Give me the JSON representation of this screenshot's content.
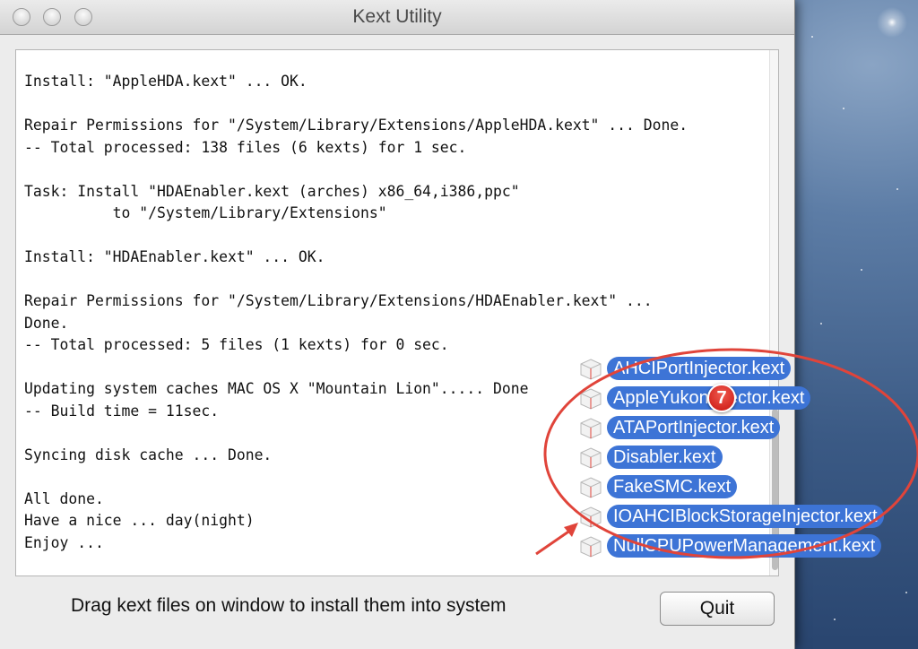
{
  "window": {
    "title": "Kext Utility"
  },
  "log": {
    "lines": [
      "Install: \"AppleHDA.kext\" ... OK.",
      "",
      "Repair Permissions for \"/System/Library/Extensions/AppleHDA.kext\" ... Done.",
      "-- Total processed: 138 files (6 kexts) for 1 sec.",
      "",
      "Task: Install \"HDAEnabler.kext (arches) x86_64,i386,ppc\"",
      "          to \"/System/Library/Extensions\"",
      "",
      "Install: \"HDAEnabler.kext\" ... OK.",
      "",
      "Repair Permissions for \"/System/Library/Extensions/HDAEnabler.kext\" ...",
      "Done.",
      "-- Total processed: 5 files (1 kexts) for 0 sec.",
      "",
      "Updating system caches MAC OS X \"Mountain Lion\"..... Done",
      "-- Build time = 11sec.",
      "",
      "Syncing disk cache ... Done.",
      "",
      "All done.",
      "Have a nice ... day(night)",
      "Enjoy ..."
    ]
  },
  "footer": {
    "hint": "Drag kext files on window to install them into system",
    "quit_label": "Quit"
  },
  "drag": {
    "badge_count": "7",
    "icon": "kext-bundle-icon",
    "items": [
      "AHCIPortInjector.kext",
      "AppleYukonInjector.kext",
      "ATAPortInjector.kext",
      "Disabler.kext",
      "FakeSMC.kext",
      "IOAHCIBlockStorageInjector.kext",
      "NullCPUPowerManagement.kext"
    ]
  },
  "annotation": {
    "color": "#e0443a"
  }
}
